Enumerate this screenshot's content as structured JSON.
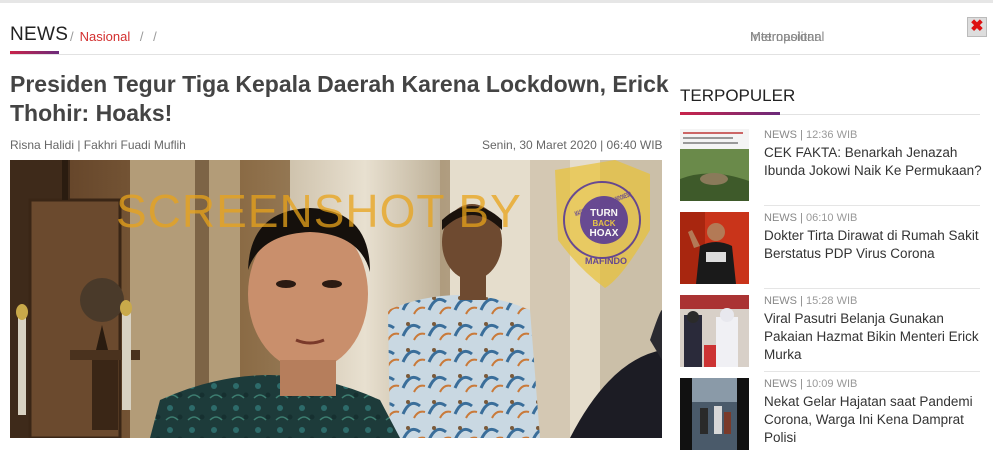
{
  "header": {
    "section": "NEWS",
    "breadcrumbs": [
      {
        "label": "Nasional",
        "active": true
      },
      {
        "label": "Metropolitan",
        "active": false
      },
      {
        "label": "Internasional",
        "active": false
      }
    ],
    "close_glyph": "✖"
  },
  "article": {
    "title": "Presiden Tegur Tiga Kepala Daerah Karena Lockdown, Erick Thohir: Hoaks!",
    "authors": "Risna Halidi | Fakhri Fuadi Muflih",
    "date": "Senin, 30 Maret 2020 | 06:40 WIB"
  },
  "watermark": {
    "text": "SCREENSHOT BY",
    "badge_arc": "MASYARAKAT ANTI FITNAH INDONESIA",
    "badge_center": [
      "TURN",
      "BACK",
      "HOAX"
    ],
    "badge_bottom": "MAFINDO"
  },
  "sidebar": {
    "title": "TERPOPULER",
    "items": [
      {
        "category": "NEWS",
        "time": "12:36 WIB",
        "title": "CEK FAKTA: Benarkah Jenazah Ibunda Jokowi Naik Ke Permukaan?"
      },
      {
        "category": "NEWS",
        "time": "06:10 WIB",
        "title": "Dokter Tirta Dirawat di Rumah Sakit Berstatus PDP Virus Corona"
      },
      {
        "category": "NEWS",
        "time": "15:28 WIB",
        "title": "Viral Pasutri Belanja Gunakan Pakaian Hazmat Bikin Menteri Erick Murka"
      },
      {
        "category": "NEWS",
        "time": "10:09 WIB",
        "title": "Nekat Gelar Hajatan saat Pandemi Corona, Warga Ini Kena Damprat Polisi"
      }
    ]
  },
  "colors": {
    "accent_red": "#d32f2f",
    "gradient_start": "#c9234a",
    "gradient_end": "#6b2a7a",
    "watermark_orange": "#e8a31a",
    "badge_purple": "#5b3b8c"
  }
}
